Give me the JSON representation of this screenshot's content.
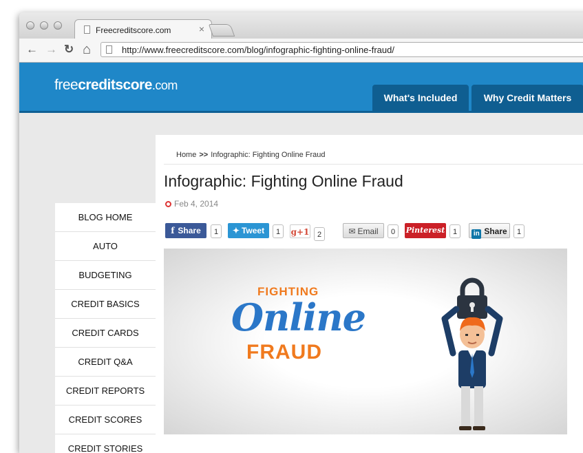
{
  "browser": {
    "tab_title": "Freecreditscore.com",
    "tab_close": "×",
    "url": "http://www.freecreditscore.com/blog/infographic-fighting-online-fraud/",
    "nav_back": "←",
    "nav_forward": "→",
    "nav_reload": "↻",
    "nav_home": "⌂"
  },
  "site": {
    "logo_free": "free",
    "logo_credit": "creditscore",
    "logo_com": ".com",
    "nav": [
      "What's Included",
      "Why Credit Matters"
    ]
  },
  "sidebar": {
    "items": [
      "BLOG HOME",
      "AUTO",
      "BUDGETING",
      "CREDIT BASICS",
      "CREDIT CARDS",
      "CREDIT Q&A",
      "CREDIT REPORTS",
      "CREDIT SCORES",
      "CREDIT STORIES"
    ]
  },
  "article": {
    "breadcrumb_home": "Home",
    "breadcrumb_sep": ">>",
    "breadcrumb_current": "Infographic: Fighting Online Fraud",
    "title": "Infographic: Fighting Online Fraud",
    "date": "Feb 4, 2014"
  },
  "share": {
    "facebook": {
      "label": "Share",
      "count": "1",
      "color": "#3b5998"
    },
    "twitter": {
      "label": "Tweet",
      "count": "1",
      "color": "#2b95d4"
    },
    "gplus": {
      "label": "g+1",
      "count": "2",
      "color": "#d34836"
    },
    "email": {
      "label": "Email",
      "count": "0"
    },
    "pinterest": {
      "label": "Pinterest",
      "count": "1",
      "color": "#cb2027"
    },
    "linkedin": {
      "label": "Share",
      "count": "1",
      "color": "#0e76a8"
    }
  },
  "hero": {
    "line1": "FIGHTING",
    "line2": "Online",
    "line3": "FRAUD"
  }
}
